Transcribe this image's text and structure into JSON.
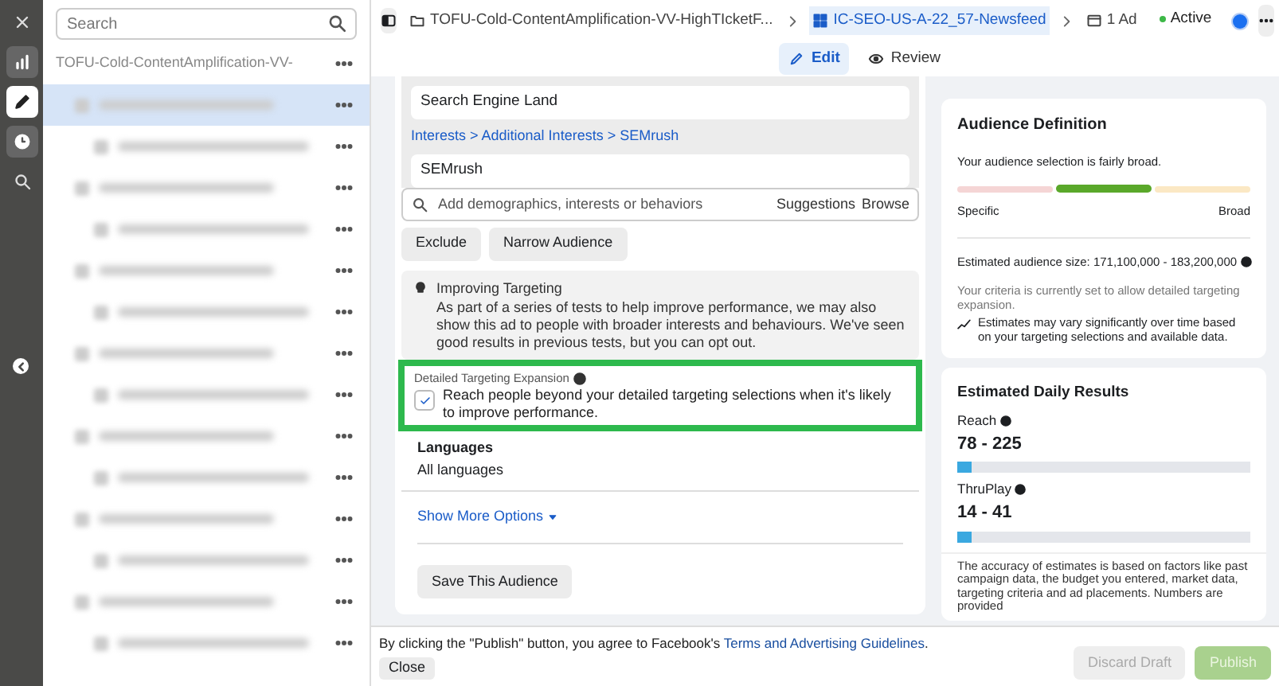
{
  "rail": {
    "items": [
      {
        "kind": "close",
        "selected": false
      },
      {
        "kind": "chart",
        "selected": false
      },
      {
        "kind": "pencil",
        "selected": true
      },
      {
        "kind": "clock",
        "selected": false
      },
      {
        "kind": "search",
        "selected": false
      }
    ]
  },
  "sidebar": {
    "search": {
      "placeholder": "Search"
    },
    "tree": [
      {
        "label": "TOFU-Cold-ContentAmplification-VV-",
        "selected": false,
        "children": [
          {
            "selected": true,
            "children": [
              {
                "selected": false
              }
            ]
          },
          {
            "selected": false,
            "children": [
              {
                "selected": false
              }
            ]
          },
          {
            "selected": false,
            "children": [
              {
                "selected": false
              }
            ]
          },
          {
            "selected": false,
            "children": [
              {
                "selected": false
              }
            ]
          },
          {
            "selected": false,
            "children": [
              {
                "selected": false
              }
            ]
          },
          {
            "selected": false,
            "children": [
              {
                "selected": false
              }
            ]
          },
          {
            "selected": false,
            "children": [
              {
                "selected": false
              }
            ]
          }
        ]
      }
    ]
  },
  "breadcrumb": [
    {
      "kind": "campaign",
      "label": "TOFU-Cold-ContentAmplification-VV-HighTIcketF...",
      "selected": false
    },
    {
      "kind": "adset",
      "label": "IC-SEO-US-A-22_57-Newsfeed",
      "selected": true
    },
    {
      "kind": "ad",
      "label": "1 Ad",
      "selected": false
    }
  ],
  "status": {
    "label": "Active",
    "on": true
  },
  "tabs": [
    {
      "label": "Edit",
      "kind": "edit",
      "selected": true
    },
    {
      "label": "Review",
      "kind": "review",
      "selected": false
    }
  ],
  "targeting": {
    "interests": [
      {
        "value": "Search Engine Land"
      },
      {
        "path": [
          "Interests",
          "Additional Interests",
          "SEMrush"
        ],
        "separator": ">",
        "value": "SEMrush"
      }
    ],
    "search": {
      "placeholder": "Add demographics, interests or behaviors",
      "links": [
        "Suggestions",
        "Browse"
      ]
    },
    "buttons": [
      "Exclude",
      "Narrow Audience"
    ],
    "notice": {
      "title": "Improving Targeting",
      "text": "As part of a series of tests to help improve performance, we may also show this ad to people with broader interests and behaviours. We've seen good results in previous tests, but you can opt out."
    },
    "expansion": {
      "label": "Detailed Targeting Expansion",
      "text": "Reach people beyond your detailed targeting selections when it's likely to improve performance.",
      "checked": true,
      "highlighted": true
    },
    "languages": {
      "label": "Languages",
      "value": "All languages"
    },
    "more_options": "Show More Options",
    "save_button": "Save This Audience"
  },
  "audience_definition": {
    "title": "Audience Definition",
    "summary": "Your audience selection is fairly broad.",
    "segments": [
      {
        "selected": false,
        "color": "#f5d5d5"
      },
      {
        "selected": true,
        "color": "#5aa82a"
      },
      {
        "selected": false,
        "color": "#fbe8c4"
      }
    ],
    "min_label": "Specific",
    "max_label": "Broad",
    "size": "Estimated audience size: 171,100,000 - 183,200,000",
    "criteria": "Your criteria is currently set to allow detailed targeting expansion.",
    "note": "Estimates may vary significantly over time based on your targeting selections and available data."
  },
  "daily_results": {
    "title": "Estimated Daily Results",
    "metrics": [
      {
        "label": "Reach",
        "value": "78 - 225",
        "level": 0.05
      },
      {
        "label": "ThruPlay",
        "value": "14 - 41",
        "level": 0.05
      }
    ],
    "disclaimer": "The accuracy of estimates is based on factors like past campaign data, the budget you entered, market data, targeting criteria and ad placements. Numbers are provided"
  },
  "footer": {
    "text_before": "By clicking the \"Publish\" button, you agree to Facebook's",
    "link": "Terms and Advertising Guidelines",
    "text_after": ".",
    "close": "Close",
    "buttons": [
      {
        "label": "Discard Draft",
        "kind": "secondary",
        "disabled": true
      },
      {
        "label": "Publish",
        "kind": "primary",
        "disabled": true
      }
    ]
  }
}
